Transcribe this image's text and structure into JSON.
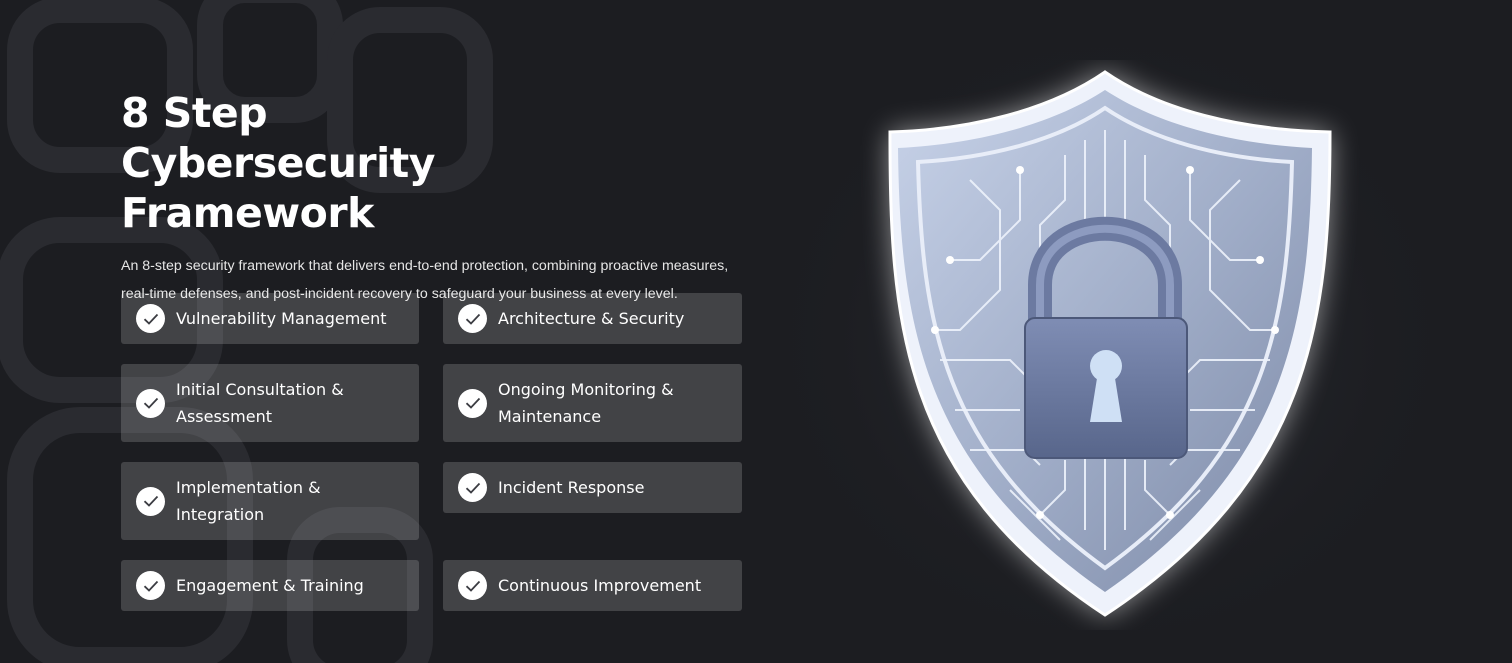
{
  "section": {
    "title": "8 Step Cybersecurity Framework",
    "description": "An 8-step security framework that delivers end-to-end protection, combining proactive measures, real-time defenses, and post-incident recovery to safeguard your business at every level."
  },
  "steps": [
    {
      "label": "Vulnerability Management"
    },
    {
      "label": "Architecture & Security"
    },
    {
      "label": "Initial Consultation & Assessment"
    },
    {
      "label": "Ongoing Monitoring & Maintenance"
    },
    {
      "label": "Implementation & Integration"
    },
    {
      "label": "Incident Response"
    },
    {
      "label": "Engagement & Training"
    },
    {
      "label": "Continuous Improvement"
    }
  ],
  "icons": {
    "step_icon": "check-circle-icon",
    "illustration": "shield-padlock-illustration"
  },
  "colors": {
    "background": "#1c1d21",
    "card": "rgba(255,255,255,0.17)",
    "text": "#ffffff",
    "shield": "#a9b7d4",
    "padlock": "#6f7ea6"
  }
}
